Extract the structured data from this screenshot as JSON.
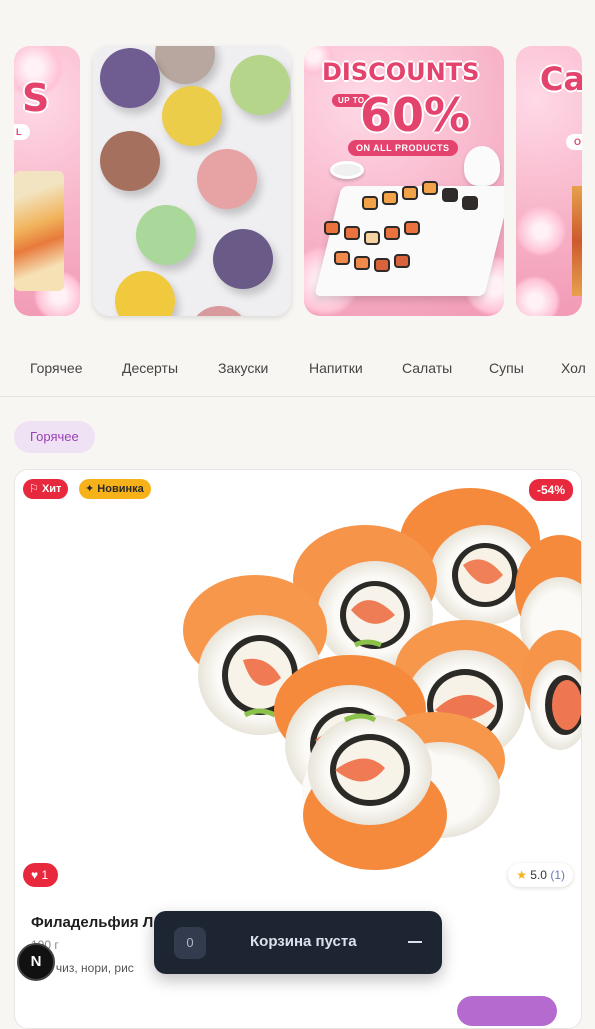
{
  "banners": {
    "discount": {
      "headline": "DISCOUNTS",
      "up_to": "UP TO",
      "percent": "60%",
      "subline": "ON ALL PRODUCTS"
    },
    "left_fragment": "S",
    "left_fragment_pill": "L",
    "right_fragment": "Ca",
    "right_fragment_pill": "O"
  },
  "categories": [
    "Горячее",
    "Десерты",
    "Закуски",
    "Напитки",
    "Салаты",
    "Супы",
    "Хол"
  ],
  "section_chip": "Горячее",
  "product": {
    "badge_hit": "Хит",
    "badge_new": "Новинка",
    "discount": "-54%",
    "likes": "1",
    "rating": "5.0",
    "rating_count": "(1)",
    "title": "Филадельфия Л",
    "weight": "190 г",
    "description": "рем чиз, нори, рис"
  },
  "cart": {
    "count": "0",
    "label": "Корзина пуста"
  },
  "dev_badge": "N",
  "colors": {
    "accent_purple": "#9a3fb6",
    "badge_red": "#e8283c",
    "badge_yellow": "#f7b21a",
    "cart_bg": "#1e2532"
  }
}
